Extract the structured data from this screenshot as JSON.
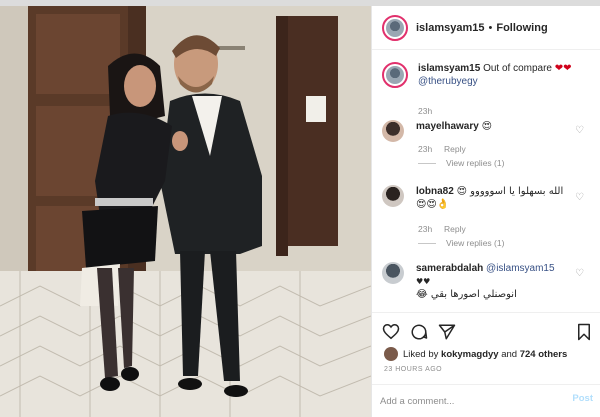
{
  "header": {
    "username": "islamsyam15",
    "separator": "•",
    "follow_status": "Following"
  },
  "caption": {
    "username": "islamsyam15",
    "text": "Out of compare",
    "hearts": "❤❤",
    "mention": "@therubyegy",
    "time": "23h"
  },
  "comments": [
    {
      "username": "mayelhawary",
      "text": "😍",
      "time": "23h",
      "reply_label": "Reply",
      "view_replies": "View replies (1)"
    },
    {
      "username": "lobna82",
      "text": "الله بسهلوا يا اسووووو 😍",
      "text2": "😍😍👌",
      "time": "23h",
      "reply_label": "Reply",
      "view_replies": "View replies (1)"
    },
    {
      "username": "samerabdalah",
      "mention": "@islamsyam15",
      "text2": "♥♥",
      "text3": "انوصنلي اصورها بقي 😂"
    }
  ],
  "likes": {
    "prefix": "Liked by",
    "user": "kokymagdyy",
    "conj": "and",
    "count": "724 others"
  },
  "time_ago": "23 HOURS AGO",
  "comment_box": {
    "placeholder": "Add a comment...",
    "post_label": "Post"
  },
  "colors": {
    "link": "#385185",
    "meta": "#8e8e8e",
    "post_disabled": "#b2dffc",
    "story_ring": "#e1306c"
  },
  "icons": [
    "heart-icon",
    "comment-icon",
    "share-icon",
    "bookmark-icon"
  ]
}
